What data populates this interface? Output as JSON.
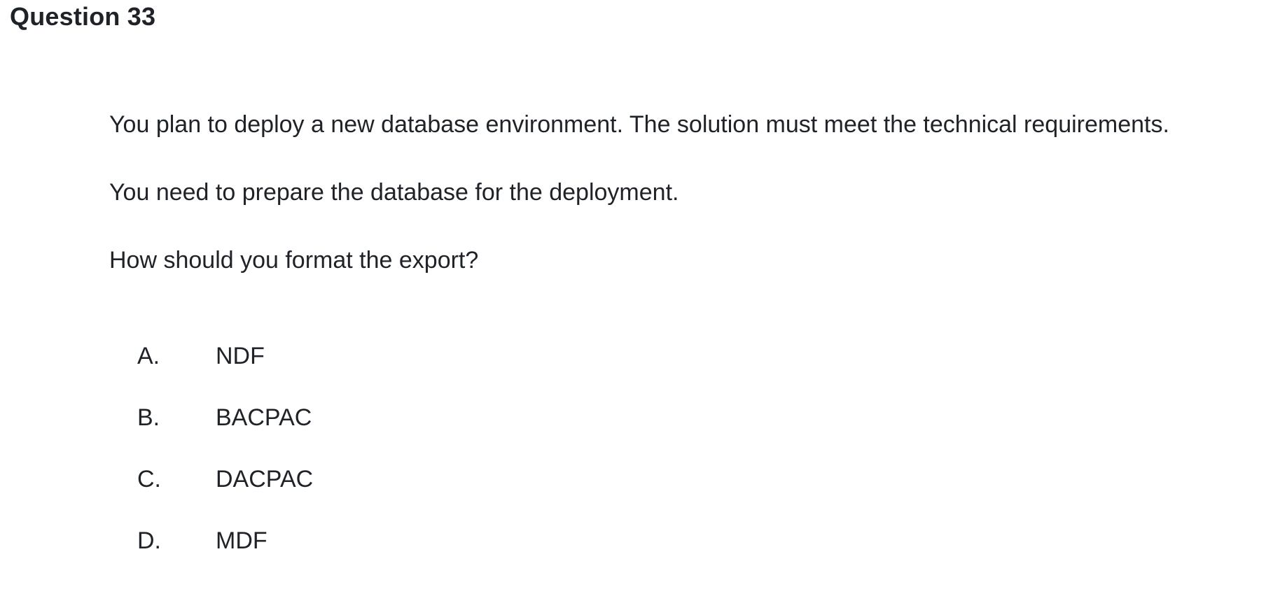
{
  "question": {
    "title": "Question 33",
    "paragraphs": [
      "You plan to deploy a new database environment. The solution must meet the technical requirements.",
      "You need to prepare the database for the deployment.",
      "How should you format the export?"
    ],
    "options": [
      {
        "letter": "A.",
        "text": "NDF"
      },
      {
        "letter": "B.",
        "text": "BACPAC"
      },
      {
        "letter": "C.",
        "text": "DACPAC"
      },
      {
        "letter": "D.",
        "text": "MDF"
      }
    ]
  }
}
